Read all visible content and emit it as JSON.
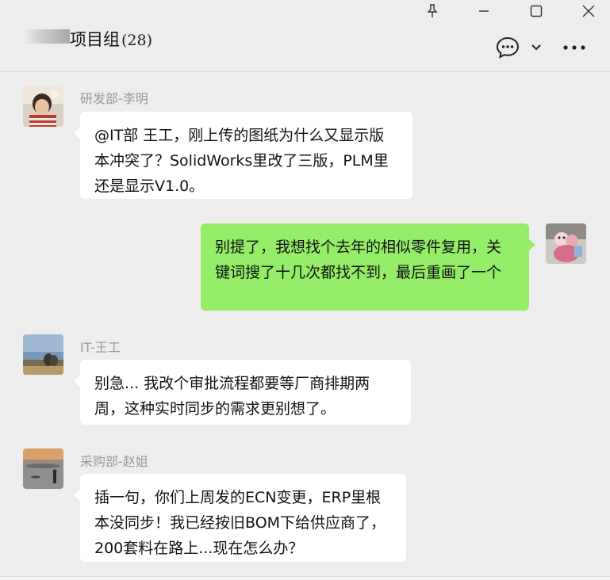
{
  "window": {
    "pin_icon": "pin-icon",
    "minimize_icon": "minimize-icon",
    "maximize_icon": "maximize-icon",
    "close_icon": "close-icon"
  },
  "header": {
    "title": "项目组",
    "member_count": "(28)",
    "chat_icon": "chat-bubble-icon",
    "dropdown_icon": "chevron-down-icon",
    "more_icon": "more-icon"
  },
  "messages": [
    {
      "sender": "研发部-李明",
      "direction": "in",
      "text": "@IT部 王工，刚上传的图纸为什么又显示版本冲突了？SolidWorks里改了三版，PLM里还是显示V1.0。"
    },
    {
      "sender": "",
      "direction": "out",
      "text": "别提了，我想找个去年的相似零件复用，关键词搜了十几次都找不到，最后重画了一个"
    },
    {
      "sender": "IT-王工",
      "direction": "in",
      "text": "别急... 我改个审批流程都要等厂商排期两周，这种实时同步的需求更别想了。"
    },
    {
      "sender": "采购部-赵姐",
      "direction": "in",
      "text": "插一句，你们上周发的ECN变更，ERP里根本没同步！我已经按旧BOM下给供应商了，200套料在路上...现在怎么办？"
    }
  ],
  "colors": {
    "background": "#ededed",
    "bubble_in": "#ffffff",
    "bubble_out": "#95ec69",
    "sender_text": "#9a9a9a"
  }
}
